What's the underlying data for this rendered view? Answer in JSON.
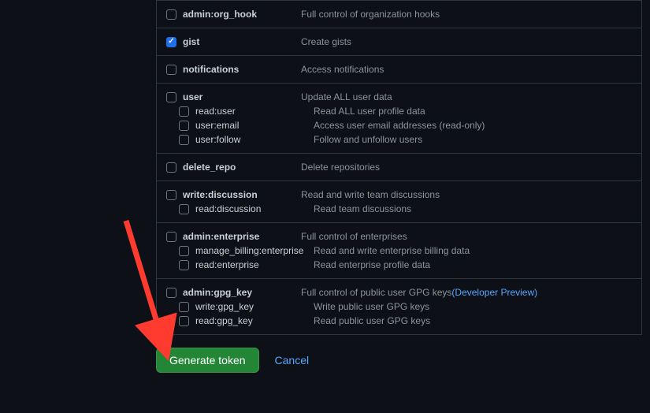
{
  "scopes": [
    {
      "name": "admin:org_hook",
      "checked": false,
      "desc": "Full control of organization hooks",
      "children": []
    },
    {
      "name": "gist",
      "checked": true,
      "desc": "Create gists",
      "children": []
    },
    {
      "name": "notifications",
      "checked": false,
      "desc": "Access notifications",
      "children": []
    },
    {
      "name": "user",
      "checked": false,
      "desc": "Update ALL user data",
      "children": [
        {
          "name": "read:user",
          "checked": false,
          "desc": "Read ALL user profile data"
        },
        {
          "name": "user:email",
          "checked": false,
          "desc": "Access user email addresses (read-only)"
        },
        {
          "name": "user:follow",
          "checked": false,
          "desc": "Follow and unfollow users"
        }
      ]
    },
    {
      "name": "delete_repo",
      "checked": false,
      "desc": "Delete repositories",
      "children": []
    },
    {
      "name": "write:discussion",
      "checked": false,
      "desc": "Read and write team discussions",
      "children": [
        {
          "name": "read:discussion",
          "checked": false,
          "desc": "Read team discussions"
        }
      ]
    },
    {
      "name": "admin:enterprise",
      "checked": false,
      "desc": "Full control of enterprises",
      "children": [
        {
          "name": "manage_billing:enterprise",
          "checked": false,
          "desc": "Read and write enterprise billing data"
        },
        {
          "name": "read:enterprise",
          "checked": false,
          "desc": "Read enterprise profile data"
        }
      ]
    },
    {
      "name": "admin:gpg_key",
      "checked": false,
      "desc": "Full control of public user GPG keys",
      "preview_link": "(Developer Preview)",
      "children": [
        {
          "name": "write:gpg_key",
          "checked": false,
          "desc": "Write public user GPG keys"
        },
        {
          "name": "read:gpg_key",
          "checked": false,
          "desc": "Read public user GPG keys"
        }
      ]
    }
  ],
  "actions": {
    "generate_label": "Generate token",
    "cancel_label": "Cancel"
  },
  "arrow_color": "#ff3b30"
}
